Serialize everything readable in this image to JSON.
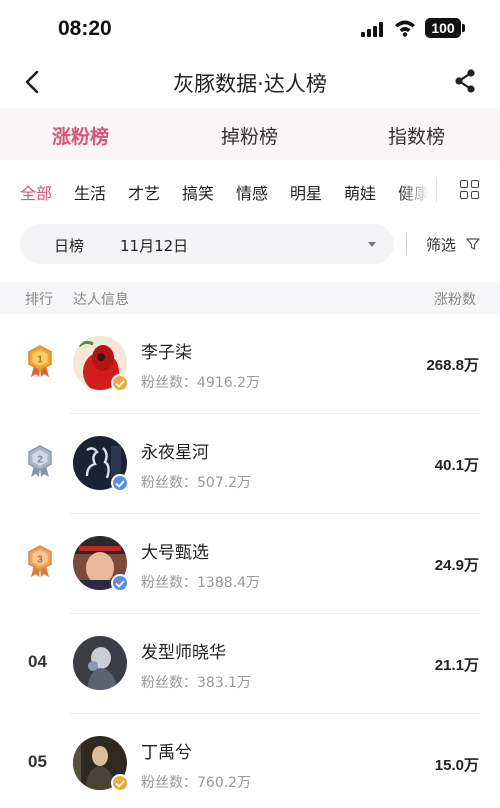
{
  "status_bar": {
    "time": "08:20",
    "battery": "100"
  },
  "nav": {
    "title": "灰豚数据·达人榜",
    "back_icon": "chevron-left-icon",
    "share_icon": "share-icon"
  },
  "tabs": [
    {
      "label": "涨粉榜",
      "active": true
    },
    {
      "label": "掉粉榜",
      "active": false
    },
    {
      "label": "指数榜",
      "active": false
    }
  ],
  "categories": [
    {
      "label": "全部",
      "active": true
    },
    {
      "label": "生活"
    },
    {
      "label": "才艺"
    },
    {
      "label": "搞笑"
    },
    {
      "label": "情感"
    },
    {
      "label": "明星"
    },
    {
      "label": "萌娃"
    },
    {
      "label": "健康"
    }
  ],
  "filter": {
    "period": "日榜",
    "date": "11月12日",
    "filter_label": "筛选"
  },
  "table_header": {
    "rank": "排行",
    "info": "达人信息",
    "gain": "涨粉数"
  },
  "rows": [
    {
      "rank": "1",
      "medal": "gold",
      "name": "李子柒",
      "fans": "粉丝数：4916.2万",
      "gain": "268.8万",
      "verify_color": "#f0a93b"
    },
    {
      "rank": "2",
      "medal": "silver",
      "name": "永夜星河",
      "fans": "粉丝数：507.2万",
      "gain": "40.1万",
      "verify_color": "#5b8def"
    },
    {
      "rank": "3",
      "medal": "bronze",
      "name": "大号甄选",
      "fans": "粉丝数：1388.4万",
      "gain": "24.9万",
      "verify_color": "#5b8def"
    },
    {
      "rank": "04",
      "name": "发型师晓华",
      "fans": "粉丝数：383.1万",
      "gain": "21.1万"
    },
    {
      "rank": "05",
      "name": "丁禹兮",
      "fans": "粉丝数：760.2万",
      "gain": "15.0万",
      "verify_color": "#f0a93b"
    }
  ],
  "colors": {
    "accent": "#d8567a",
    "gold": "#f3a53a",
    "silver": "#a9b4c8",
    "bronze": "#f0a45e"
  }
}
